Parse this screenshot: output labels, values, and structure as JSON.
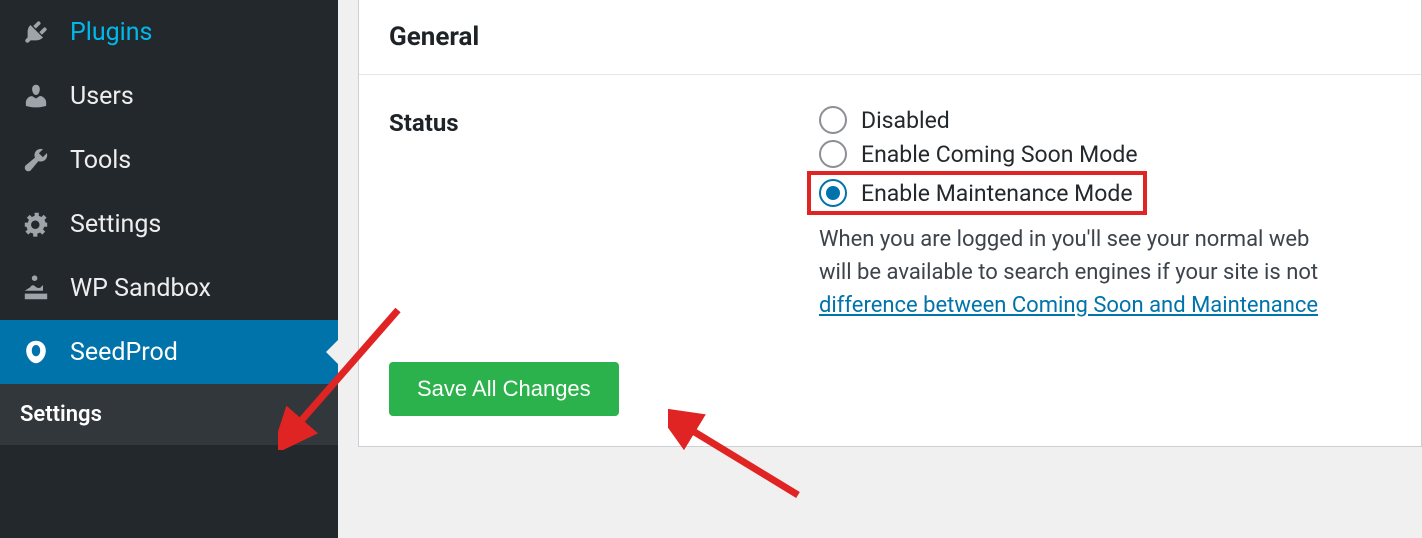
{
  "sidebar": {
    "items": [
      {
        "label": "Plugins",
        "icon": "plugin-icon"
      },
      {
        "label": "Users",
        "icon": "users-icon"
      },
      {
        "label": "Tools",
        "icon": "tools-icon"
      },
      {
        "label": "Settings",
        "icon": "settings-icon"
      },
      {
        "label": "WP Sandbox",
        "icon": "sandbox-icon"
      },
      {
        "label": "SeedProd",
        "icon": "seedprod-icon"
      }
    ],
    "submenu_label": "Settings"
  },
  "panel": {
    "heading": "General",
    "status": {
      "label": "Status",
      "options": [
        {
          "label": "Disabled",
          "checked": false
        },
        {
          "label": "Enable Coming Soon Mode",
          "checked": false
        },
        {
          "label": "Enable Maintenance Mode",
          "checked": true
        }
      ],
      "description_line1": "When you are logged in you'll see your normal web",
      "description_line2": "will be available to search engines if your site is not",
      "link_text": "difference between Coming Soon and Maintenance"
    },
    "save_button": "Save All Changes"
  }
}
